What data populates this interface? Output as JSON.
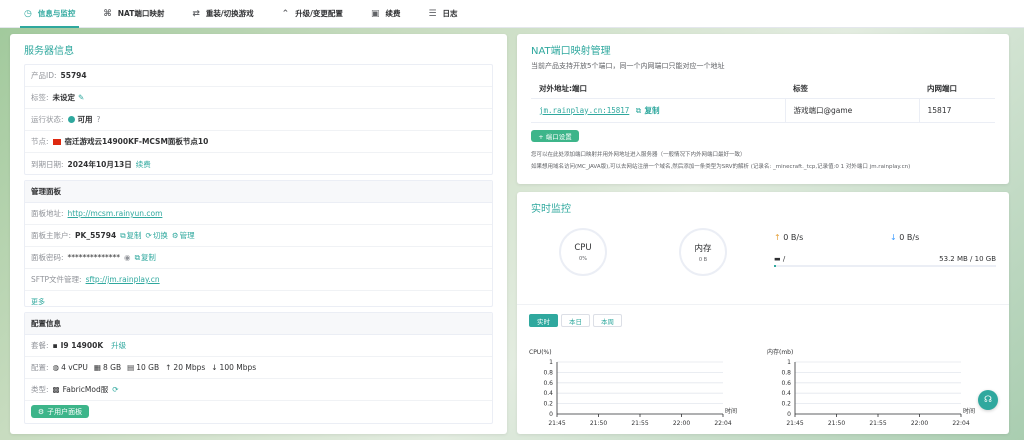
{
  "tabs": [
    {
      "label": "信息与监控",
      "icon": "clock-icon",
      "glyph": "◷"
    },
    {
      "label": "NAT端口映射",
      "icon": "network-icon",
      "glyph": "⌘"
    },
    {
      "label": "重装/切换游戏",
      "icon": "swap-icon",
      "glyph": "⇄"
    },
    {
      "label": "升级/变更配置",
      "icon": "double-chevron-up-icon",
      "glyph": "⌃"
    },
    {
      "label": "续费",
      "icon": "wallet-icon",
      "glyph": "▣"
    },
    {
      "label": "日志",
      "icon": "list-icon",
      "glyph": "☰"
    }
  ],
  "server_info": {
    "title": "服务器信息",
    "product_id_label": "产品ID:",
    "product_id": "55794",
    "tag_label": "标签:",
    "tag_value": "未设定",
    "status_label": "运行状态:",
    "status_value": "可用",
    "node_label": "节点:",
    "node_value": "宿迁游戏云14900KF-MCSM面板节点10",
    "expire_label": "到期日期:",
    "expire_value": "2024年10月13日",
    "renew_label": "续费"
  },
  "panel": {
    "title": "管理面板",
    "url_label": "面板地址:",
    "url": "http://mcsm.rainyun.com",
    "account_label": "面板主账户:",
    "account": "PK_55794",
    "copy_label": "复制",
    "switch_label": "切换",
    "manage_label": "管理",
    "password_label": "面板密码:",
    "password": "**************",
    "sftp_label": "SFTP文件管理:",
    "sftp": "sftp://jm.rainplay.cn",
    "more_label": "更多"
  },
  "config": {
    "title": "配置信息",
    "plan_label": "套餐:",
    "plan": "I9 14900K",
    "upgrade_label": "升级",
    "spec_label": "配置:",
    "cpu": "4 vCPU",
    "ram": "8 GB",
    "disk": "10 GB",
    "up": "20 Mbps",
    "down": "100 Mbps",
    "type_label": "类型:",
    "type": "FabricMod服",
    "sub_user_button": "子用户面板"
  },
  "nat": {
    "title": "NAT端口映射管理",
    "desc": "当前产品支持开放5个端口，同一个内网端口只能对应一个地址",
    "headers": [
      "对外地址:端口",
      "标签",
      "内网端口"
    ],
    "rows": [
      {
        "address": "jm.rainplay.cn:15817",
        "copy": "复制",
        "tag": "游戏端口@game",
        "port": "15817"
      }
    ],
    "add_button": "+ 端口设置",
    "note1": "您可以在此处添加端口映射并用外网地址进入服务器（一般情况下内外网端口最好一致）",
    "note2": "如果想用域名访问(MC_JAVA版),可以去网站注册一个域名,然后添加一条类型为SRV的解析 (记录名: _minecraft._tcp,记录值:0 1 对外端口 jm.rainplay.cn)"
  },
  "monitor": {
    "title": "实时监控",
    "cpu_name": "CPU",
    "cpu_value": "0%",
    "mem_name": "内存",
    "mem_value": "0 B",
    "up_rate": "0 B/s",
    "down_rate": "0 B/s",
    "disk_path": "/",
    "disk_usage": "53.2 MB / 10 GB",
    "ranges": [
      "实时",
      "本日",
      "本周"
    ],
    "active_range": 0
  },
  "chart_data": [
    {
      "type": "line",
      "title": "CPU(%)",
      "xlabel": "时间",
      "x": [
        "21:45",
        "21:50",
        "21:55",
        "22:00",
        "22:04"
      ],
      "yticks": [
        "0",
        "0.2",
        "0.4",
        "0.6",
        "0.8",
        "1"
      ],
      "ylim": [
        0,
        1
      ],
      "series": []
    },
    {
      "type": "line",
      "title": "内存(mb)",
      "xlabel": "时间",
      "x": [
        "21:45",
        "21:50",
        "21:55",
        "22:00",
        "22:04"
      ],
      "yticks": [
        "0",
        "0.2",
        "0.4",
        "0.6",
        "0.8",
        "1"
      ],
      "ylim": [
        0,
        1
      ],
      "series": []
    }
  ],
  "colors": {
    "accent": "#2fa89e",
    "button": "#3db58a"
  }
}
